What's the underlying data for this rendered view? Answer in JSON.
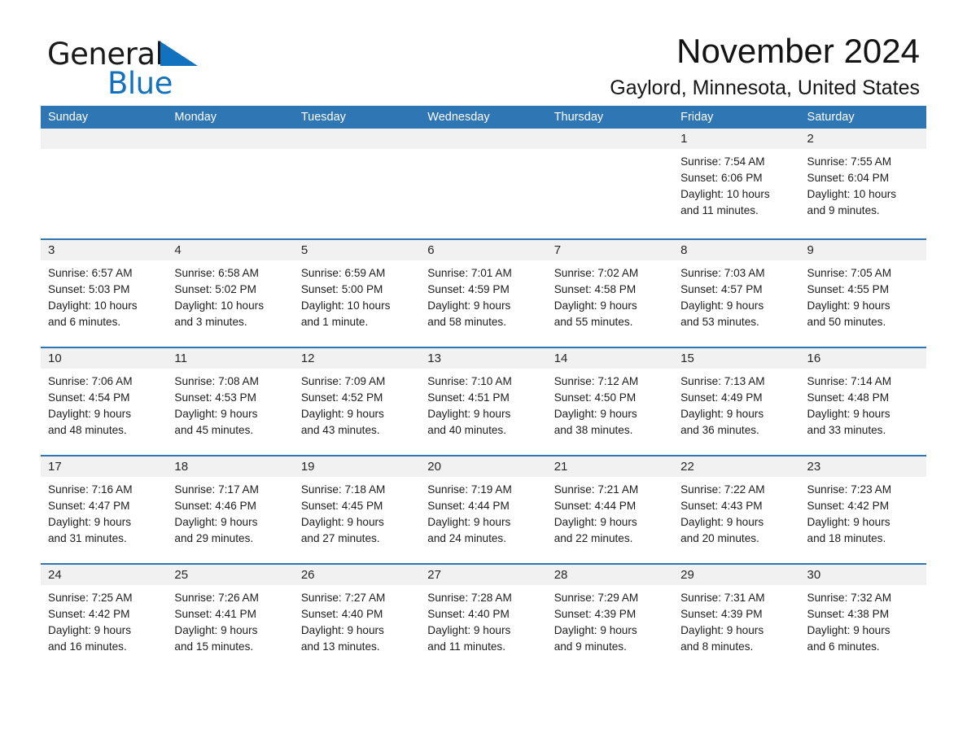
{
  "brand": {
    "name_part1": "General",
    "name_part2": "Blue",
    "logo_icon": "blue-triangle-icon",
    "accent_color": "#1272bd"
  },
  "header": {
    "title": "November 2024",
    "location": "Gaylord, Minnesota, United States"
  },
  "calendar": {
    "header_color": "#2f76b4",
    "daynum_band_color": "#f1f1f1",
    "weekdays": [
      "Sunday",
      "Monday",
      "Tuesday",
      "Wednesday",
      "Thursday",
      "Friday",
      "Saturday"
    ],
    "weeks": [
      [
        {
          "day": "",
          "lines": []
        },
        {
          "day": "",
          "lines": []
        },
        {
          "day": "",
          "lines": []
        },
        {
          "day": "",
          "lines": []
        },
        {
          "day": "",
          "lines": []
        },
        {
          "day": "1",
          "lines": [
            "Sunrise: 7:54 AM",
            "Sunset: 6:06 PM",
            "Daylight: 10 hours",
            "and 11 minutes."
          ]
        },
        {
          "day": "2",
          "lines": [
            "Sunrise: 7:55 AM",
            "Sunset: 6:04 PM",
            "Daylight: 10 hours",
            "and 9 minutes."
          ]
        }
      ],
      [
        {
          "day": "3",
          "lines": [
            "Sunrise: 6:57 AM",
            "Sunset: 5:03 PM",
            "Daylight: 10 hours",
            "and 6 minutes."
          ]
        },
        {
          "day": "4",
          "lines": [
            "Sunrise: 6:58 AM",
            "Sunset: 5:02 PM",
            "Daylight: 10 hours",
            "and 3 minutes."
          ]
        },
        {
          "day": "5",
          "lines": [
            "Sunrise: 6:59 AM",
            "Sunset: 5:00 PM",
            "Daylight: 10 hours",
            "and 1 minute."
          ]
        },
        {
          "day": "6",
          "lines": [
            "Sunrise: 7:01 AM",
            "Sunset: 4:59 PM",
            "Daylight: 9 hours",
            "and 58 minutes."
          ]
        },
        {
          "day": "7",
          "lines": [
            "Sunrise: 7:02 AM",
            "Sunset: 4:58 PM",
            "Daylight: 9 hours",
            "and 55 minutes."
          ]
        },
        {
          "day": "8",
          "lines": [
            "Sunrise: 7:03 AM",
            "Sunset: 4:57 PM",
            "Daylight: 9 hours",
            "and 53 minutes."
          ]
        },
        {
          "day": "9",
          "lines": [
            "Sunrise: 7:05 AM",
            "Sunset: 4:55 PM",
            "Daylight: 9 hours",
            "and 50 minutes."
          ]
        }
      ],
      [
        {
          "day": "10",
          "lines": [
            "Sunrise: 7:06 AM",
            "Sunset: 4:54 PM",
            "Daylight: 9 hours",
            "and 48 minutes."
          ]
        },
        {
          "day": "11",
          "lines": [
            "Sunrise: 7:08 AM",
            "Sunset: 4:53 PM",
            "Daylight: 9 hours",
            "and 45 minutes."
          ]
        },
        {
          "day": "12",
          "lines": [
            "Sunrise: 7:09 AM",
            "Sunset: 4:52 PM",
            "Daylight: 9 hours",
            "and 43 minutes."
          ]
        },
        {
          "day": "13",
          "lines": [
            "Sunrise: 7:10 AM",
            "Sunset: 4:51 PM",
            "Daylight: 9 hours",
            "and 40 minutes."
          ]
        },
        {
          "day": "14",
          "lines": [
            "Sunrise: 7:12 AM",
            "Sunset: 4:50 PM",
            "Daylight: 9 hours",
            "and 38 minutes."
          ]
        },
        {
          "day": "15",
          "lines": [
            "Sunrise: 7:13 AM",
            "Sunset: 4:49 PM",
            "Daylight: 9 hours",
            "and 36 minutes."
          ]
        },
        {
          "day": "16",
          "lines": [
            "Sunrise: 7:14 AM",
            "Sunset: 4:48 PM",
            "Daylight: 9 hours",
            "and 33 minutes."
          ]
        }
      ],
      [
        {
          "day": "17",
          "lines": [
            "Sunrise: 7:16 AM",
            "Sunset: 4:47 PM",
            "Daylight: 9 hours",
            "and 31 minutes."
          ]
        },
        {
          "day": "18",
          "lines": [
            "Sunrise: 7:17 AM",
            "Sunset: 4:46 PM",
            "Daylight: 9 hours",
            "and 29 minutes."
          ]
        },
        {
          "day": "19",
          "lines": [
            "Sunrise: 7:18 AM",
            "Sunset: 4:45 PM",
            "Daylight: 9 hours",
            "and 27 minutes."
          ]
        },
        {
          "day": "20",
          "lines": [
            "Sunrise: 7:19 AM",
            "Sunset: 4:44 PM",
            "Daylight: 9 hours",
            "and 24 minutes."
          ]
        },
        {
          "day": "21",
          "lines": [
            "Sunrise: 7:21 AM",
            "Sunset: 4:44 PM",
            "Daylight: 9 hours",
            "and 22 minutes."
          ]
        },
        {
          "day": "22",
          "lines": [
            "Sunrise: 7:22 AM",
            "Sunset: 4:43 PM",
            "Daylight: 9 hours",
            "and 20 minutes."
          ]
        },
        {
          "day": "23",
          "lines": [
            "Sunrise: 7:23 AM",
            "Sunset: 4:42 PM",
            "Daylight: 9 hours",
            "and 18 minutes."
          ]
        }
      ],
      [
        {
          "day": "24",
          "lines": [
            "Sunrise: 7:25 AM",
            "Sunset: 4:42 PM",
            "Daylight: 9 hours",
            "and 16 minutes."
          ]
        },
        {
          "day": "25",
          "lines": [
            "Sunrise: 7:26 AM",
            "Sunset: 4:41 PM",
            "Daylight: 9 hours",
            "and 15 minutes."
          ]
        },
        {
          "day": "26",
          "lines": [
            "Sunrise: 7:27 AM",
            "Sunset: 4:40 PM",
            "Daylight: 9 hours",
            "and 13 minutes."
          ]
        },
        {
          "day": "27",
          "lines": [
            "Sunrise: 7:28 AM",
            "Sunset: 4:40 PM",
            "Daylight: 9 hours",
            "and 11 minutes."
          ]
        },
        {
          "day": "28",
          "lines": [
            "Sunrise: 7:29 AM",
            "Sunset: 4:39 PM",
            "Daylight: 9 hours",
            "and 9 minutes."
          ]
        },
        {
          "day": "29",
          "lines": [
            "Sunrise: 7:31 AM",
            "Sunset: 4:39 PM",
            "Daylight: 9 hours",
            "and 8 minutes."
          ]
        },
        {
          "day": "30",
          "lines": [
            "Sunrise: 7:32 AM",
            "Sunset: 4:38 PM",
            "Daylight: 9 hours",
            "and 6 minutes."
          ]
        }
      ]
    ]
  }
}
